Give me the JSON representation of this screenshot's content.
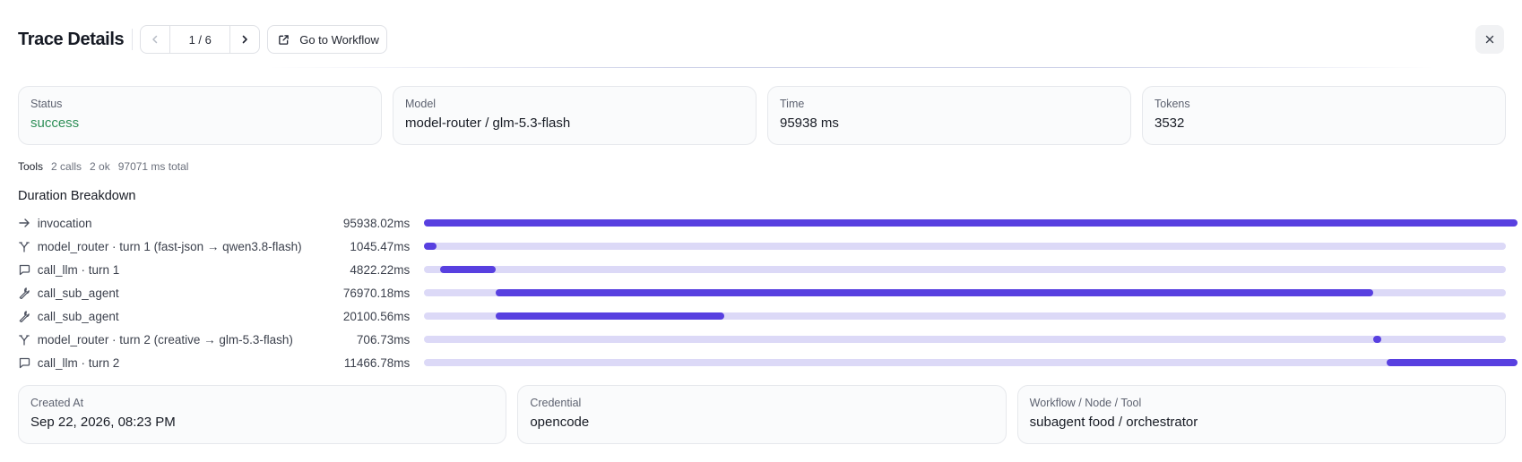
{
  "header": {
    "title": "Trace Details",
    "pager_label": "1 / 6",
    "goto_label": "Go to Workflow"
  },
  "stats": [
    {
      "label": "Status",
      "value": "success",
      "tone": "success"
    },
    {
      "label": "Model",
      "value": "model-router / glm-5.3-flash",
      "tone": ""
    },
    {
      "label": "Time",
      "value": "95938 ms",
      "tone": ""
    },
    {
      "label": "Tokens",
      "value": "3532",
      "tone": ""
    }
  ],
  "tools": {
    "label": "Tools",
    "calls": "2 calls",
    "ok": "2 ok",
    "total": "97071 ms total"
  },
  "duration": {
    "title": "Duration Breakdown",
    "rows": [
      {
        "icon": "arrow-right-icon",
        "name": "invocation",
        "ms": "95938.02ms",
        "start": 0.0,
        "fraction": 1.0
      },
      {
        "icon": "router-branch-icon",
        "name": "model_router · turn 1 (fast-json → qwen3.8-flash)",
        "ms": "1045.47ms",
        "start": 0.0,
        "fraction": 0.0109
      },
      {
        "icon": "chat-bubble-icon",
        "name": "call_llm · turn 1",
        "ms": "4822.22ms",
        "start": 0.0149,
        "fraction": 0.0503
      },
      {
        "icon": "wrench-icon",
        "name": "call_sub_agent",
        "ms": "76970.18ms",
        "start": 0.0652,
        "fraction": 0.8023
      },
      {
        "icon": "wrench-icon",
        "name": "call_sub_agent",
        "ms": "20100.56ms",
        "start": 0.0652,
        "fraction": 0.2095
      },
      {
        "icon": "router-branch-icon",
        "name": "model_router · turn 2 (creative → glm-5.3-flash)",
        "ms": "706.73ms",
        "start": 0.8676,
        "fraction": 0.0074
      },
      {
        "icon": "chat-bubble-icon",
        "name": "call_llm · turn 2",
        "ms": "11466.78ms",
        "start": 0.8805,
        "fraction": 0.1195
      }
    ]
  },
  "meta": [
    {
      "label": "Created At",
      "value": "Sep 22, 2026, 08:23 PM"
    },
    {
      "label": "Credential",
      "value": "opencode"
    },
    {
      "label": "Workflow / Node / Tool",
      "value": "subagent food / orchestrator"
    }
  ],
  "colors": {
    "accent": "#5840e0",
    "track": "#dcd9f7",
    "success": "#2f8f58"
  }
}
